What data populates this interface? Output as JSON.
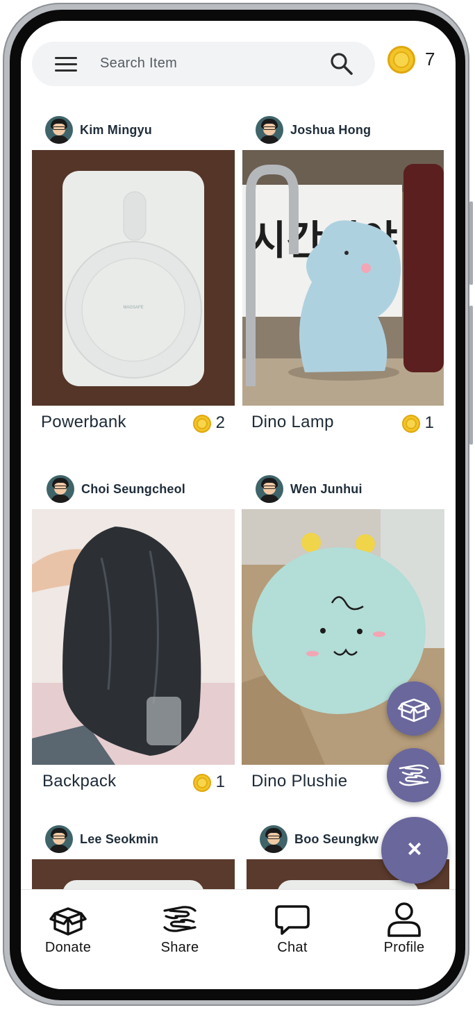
{
  "search": {
    "placeholder": "Search Item"
  },
  "wallet": {
    "coins": "7"
  },
  "items": [
    {
      "user": "Kim Mingyu",
      "title": "Powerbank",
      "price": "2"
    },
    {
      "user": "Joshua Hong",
      "title": "Dino Lamp",
      "price": "1"
    },
    {
      "user": "Choi Seungcheol",
      "title": "Backpack",
      "price": "1"
    },
    {
      "user": "Wen Junhui",
      "title": "Dino Plushie",
      "price": ""
    },
    {
      "user": "Lee Seokmin",
      "title": "",
      "price": ""
    },
    {
      "user": "Boo Seungkw",
      "title": "",
      "price": ""
    }
  ],
  "nav": {
    "donate": "Donate",
    "share": "Share",
    "chat": "Chat",
    "profile": "Profile"
  },
  "fab": {
    "close_symbol": "×"
  },
  "colors": {
    "accent": "#6a679c",
    "coin": "#f2c428",
    "text": "#1d2a36"
  },
  "icons": [
    "menu-icon",
    "search-icon",
    "coin-icon",
    "box-icon",
    "hands-share-icon",
    "close-icon",
    "chat-bubble-icon",
    "person-icon"
  ]
}
